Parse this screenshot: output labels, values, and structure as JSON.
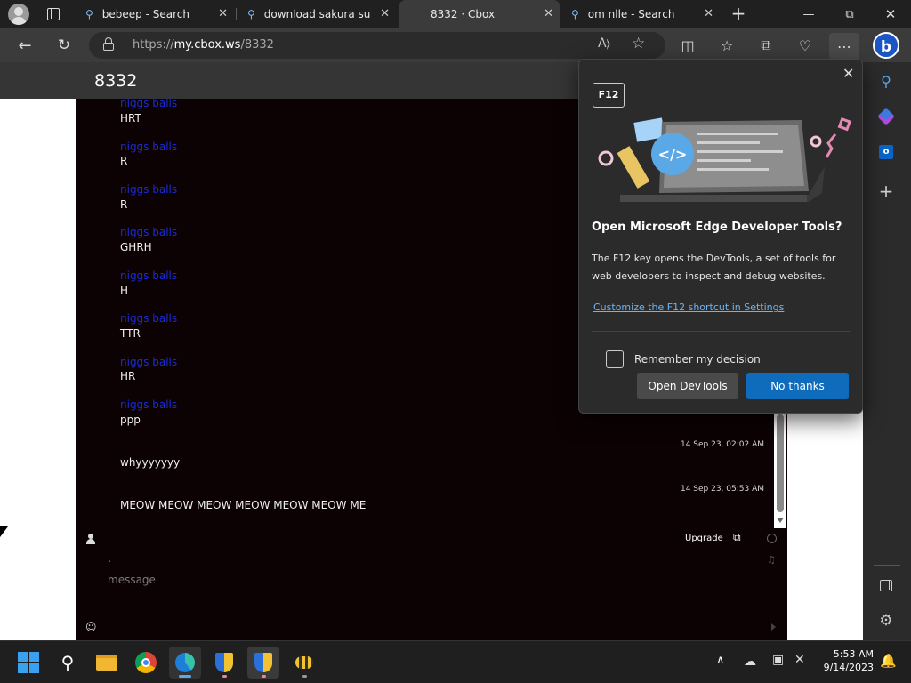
{
  "tabs": [
    {
      "label": "bebeep - Search",
      "active": false
    },
    {
      "label": "download sakura succ",
      "active": false
    },
    {
      "label": "8332 · Cbox",
      "active": true
    },
    {
      "label": "om nlle - Search",
      "active": false
    }
  ],
  "address": {
    "prefix": "https://",
    "host": "my.cbox.ws",
    "path": "/8332"
  },
  "page": {
    "title": "8332"
  },
  "chat": {
    "messages": [
      {
        "user": "niggs balls",
        "text": "HRT"
      },
      {
        "user": "niggs balls",
        "text": "R"
      },
      {
        "user": "niggs balls",
        "text": "R"
      },
      {
        "user": "niggs balls",
        "text": "GHRH"
      },
      {
        "user": "niggs balls",
        "text": "H"
      },
      {
        "user": "niggs balls",
        "text": "TTR"
      },
      {
        "user": "niggs balls",
        "text": "HR"
      },
      {
        "user": "niggs balls",
        "text": "ppp"
      }
    ],
    "timed": [
      {
        "timestamp": "14 Sep 23, 02:02 AM",
        "text": "whyyyyyyy"
      },
      {
        "timestamp": "14 Sep 23, 05:53 AM",
        "text": "MEOW MEOW MEOW MEOW MEOW MEOW ME"
      }
    ],
    "upgrade_label": "Upgrade",
    "name_value": ".",
    "message_placeholder": "message"
  },
  "popup": {
    "key_badge": "F12",
    "title": "Open Microsoft Edge Developer Tools?",
    "body": "The F12 key opens the DevTools, a set of tools for web developers to inspect and debug websites.",
    "link": "Customize the F12 shortcut in Settings",
    "checkbox_label": "Remember my decision",
    "open_button": "Open DevTools",
    "no_button": "No thanks"
  },
  "taskbar": {
    "time": "5:53 AM",
    "date": "9/14/2023"
  },
  "colors": {
    "accent": "#0f6cbd",
    "link": "#6cb4f5",
    "chat_bg": "#0c0203",
    "username": "#1a2bd6"
  }
}
